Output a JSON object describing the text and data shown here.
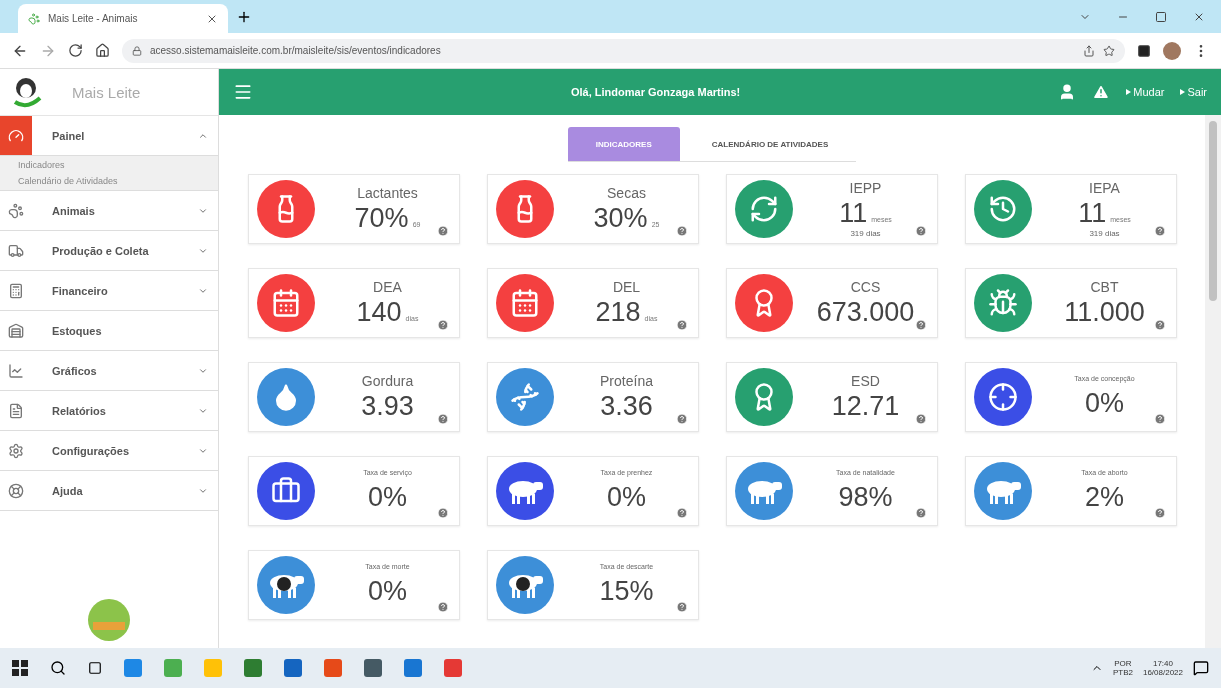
{
  "browser": {
    "tab_title": "Mais Leite - Animais",
    "url": "acesso.sistemamaisleite.com.br/maisleite/sis/eventos/indicadores"
  },
  "app": {
    "name": "Mais Leite",
    "greeting": "Olá, Lindomar Gonzaga Martins!",
    "actions": [
      "Mudar",
      "Sair"
    ]
  },
  "sidebar": {
    "items": [
      {
        "label": "Painel",
        "selected": true,
        "has_menu": true,
        "expanded": true,
        "children": [
          {
            "label": "Indicadores"
          },
          {
            "label": "Calendário de Atividades"
          }
        ]
      },
      {
        "label": "Animais",
        "selected": false,
        "has_menu": true,
        "expanded": false
      },
      {
        "label": "Produção e Coleta",
        "selected": false,
        "has_menu": true,
        "expanded": false
      },
      {
        "label": "Financeiro",
        "selected": false,
        "has_menu": true,
        "expanded": false
      },
      {
        "label": "Estoques",
        "selected": false,
        "has_menu": false
      },
      {
        "label": "Gráficos",
        "selected": false,
        "has_menu": true,
        "expanded": false
      },
      {
        "label": "Relatórios",
        "selected": false,
        "has_menu": true,
        "expanded": false
      },
      {
        "label": "Configurações",
        "selected": false,
        "has_menu": true,
        "expanded": false
      },
      {
        "label": "Ajuda",
        "selected": false,
        "has_menu": true,
        "expanded": false
      }
    ]
  },
  "tabs": [
    {
      "label": "INDICADORES",
      "selected": true
    },
    {
      "label": "CALENDÁRIO DE ATIVIDADES",
      "selected": false
    }
  ],
  "cards": [
    {
      "kind": "indicator",
      "title": "Lactantes",
      "value": "70%",
      "unit": "69",
      "color": "#f44040"
    },
    {
      "kind": "indicator",
      "title": "Secas",
      "value": "30%",
      "unit": "25",
      "color": "#f44040"
    },
    {
      "kind": "indicator",
      "title": "IEPP",
      "value": "11",
      "unit": "meses",
      "note": "319 dias",
      "color": "#27a070"
    },
    {
      "kind": "indicator",
      "title": "IEPA",
      "value": "11",
      "unit": "meses",
      "note": "319 dias",
      "color": "#27a070"
    },
    {
      "kind": "indicator",
      "title": "DEA",
      "value": "140",
      "unit": "dias",
      "color": "#f44040"
    },
    {
      "kind": "indicator",
      "title": "DEL",
      "value": "218",
      "unit": "dias",
      "color": "#f44040"
    },
    {
      "kind": "indicator",
      "title": "CCS",
      "value": "673.000",
      "color": "#f44040"
    },
    {
      "kind": "indicator",
      "title": "CBT",
      "value": "11.000",
      "color": "#27a070"
    },
    {
      "kind": "indicator",
      "title": "Gordura",
      "value": "3.93",
      "color": "#3d8fd8"
    },
    {
      "kind": "indicator",
      "title": "Proteína",
      "value": "3.36",
      "color": "#3d8fd8"
    },
    {
      "kind": "indicator",
      "title": "ESD",
      "value": "12.71",
      "color": "#27a070"
    },
    {
      "kind": "rate",
      "title": "Taxa de concepção",
      "value": "0%",
      "color": "#3b4ee6"
    },
    {
      "kind": "rate",
      "title": "Taxa de serviço",
      "value": "0%",
      "color": "#3b4ee6"
    },
    {
      "kind": "rate",
      "title": "Taxa de prenhez",
      "value": "0%",
      "color": "#3b4ee6"
    },
    {
      "kind": "rate",
      "title": "Taxa de natalidade",
      "value": "98%",
      "color": "#3d8fd8"
    },
    {
      "kind": "rate",
      "title": "Taxa de aborto",
      "value": "2%",
      "color": "#3d8fd8"
    },
    {
      "kind": "rate",
      "title": "Taxa de morte",
      "value": "0%",
      "color": "#3d8fd8"
    },
    {
      "kind": "rate",
      "title": "Taxa de descarte",
      "value": "15%",
      "color": "#3d8fd8"
    }
  ],
  "taskbar": {
    "language": "POR",
    "layout": "PTB2",
    "time": "17:40",
    "date": "16/08/2022"
  }
}
